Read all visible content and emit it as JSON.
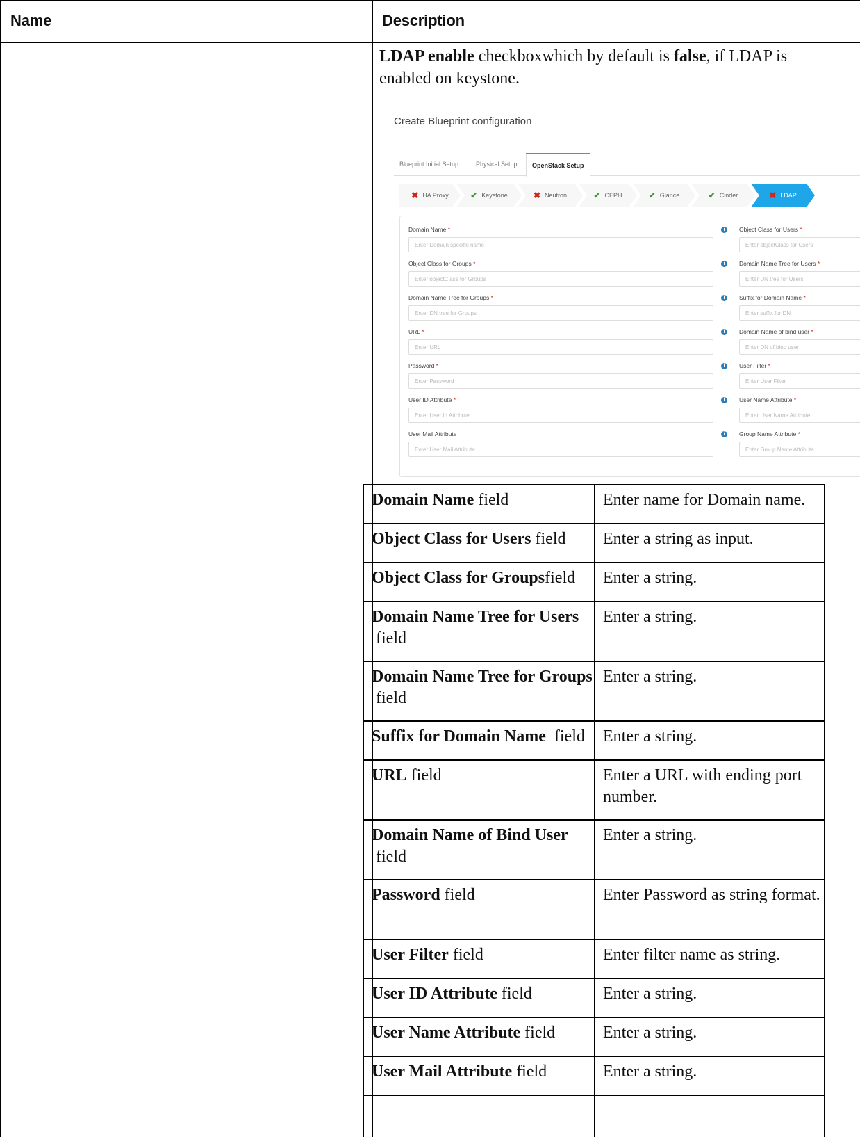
{
  "header": {
    "name": "Name",
    "description": "Description"
  },
  "intro": {
    "part1_bold": "LDAP enable",
    "part2": " checkboxwhich by default is ",
    "part3_bold": "false",
    "part4": ", if LDAP is enabled on keystone."
  },
  "screenshot": {
    "title": "Create Blueprint configuration",
    "tabs": [
      "Blueprint Initial Setup",
      "Physical Setup",
      "OpenStack Setup"
    ],
    "active_tab": "OpenStack Setup",
    "steps": [
      {
        "label": "HA Proxy",
        "status": "error"
      },
      {
        "label": "Keystone",
        "status": "ok"
      },
      {
        "label": "Neutron",
        "status": "error"
      },
      {
        "label": "CEPH",
        "status": "ok"
      },
      {
        "label": "Glance",
        "status": "ok"
      },
      {
        "label": "Cinder",
        "status": "ok"
      },
      {
        "label": "LDAP",
        "status": "error"
      }
    ],
    "marks": {
      "error": "✖",
      "ok": "✔"
    },
    "info_glyph": "i",
    "required_mark": " *",
    "left_fields": [
      {
        "label": "Domain Name",
        "required": true,
        "placeholder": "Enter Domain specific name"
      },
      {
        "label": "Object Class for Groups",
        "required": true,
        "placeholder": "Enter objectClass for Groups"
      },
      {
        "label": "Domain Name Tree for Groups",
        "required": true,
        "placeholder": "Enter DN tree for Groups"
      },
      {
        "label": "URL",
        "required": true,
        "placeholder": "Enter URL"
      },
      {
        "label": "Password",
        "required": true,
        "placeholder": "Enter Password"
      },
      {
        "label": "User ID Attribute",
        "required": true,
        "placeholder": "Enter User Id Attribute"
      },
      {
        "label": "User Mail Attribute",
        "required": false,
        "placeholder": "Enter User Mail Attribute"
      }
    ],
    "right_fields": [
      {
        "label": "Object Class for Users",
        "required": true,
        "placeholder": "Enter objectClass for Users"
      },
      {
        "label": "Domain Name Tree for Users",
        "required": true,
        "placeholder": "Enter DN tree for Users"
      },
      {
        "label": "Suffix for Domain Name",
        "required": true,
        "placeholder": "Enter suffix for DN"
      },
      {
        "label": "Domain Name of bind user",
        "required": true,
        "placeholder": "Enter DN of bind user"
      },
      {
        "label": "User Filter",
        "required": true,
        "placeholder": "Enter User Filter"
      },
      {
        "label": "User Name Attribute",
        "required": true,
        "placeholder": "Enter User Name Attribute"
      },
      {
        "label": "Group Name Attribute",
        "required": true,
        "placeholder": "Enter Group Name Attribute"
      }
    ]
  },
  "fields_table": [
    {
      "name_bold": "Domain Name",
      "name_suffix": " field",
      "desc": "Enter name for Domain name."
    },
    {
      "name_bold": "Object Class for Users",
      "name_suffix": " field",
      "desc": "Enter a string as input."
    },
    {
      "name_bold": "Object Class for Groups",
      "name_suffix": "field",
      "desc": "Enter a string."
    },
    {
      "name_bold": "Domain Name Tree for Users",
      "name_suffix": " field",
      "desc": "Enter a string."
    },
    {
      "name_bold": "Domain Name Tree for Groups",
      "name_suffix": " field",
      "desc": "Enter a string."
    },
    {
      "name_bold": "Suffix for Domain Name",
      "name_suffix": "  field",
      "desc": "Enter a string."
    },
    {
      "name_bold": "URL",
      "name_suffix": " field",
      "desc": "Enter a URL with ending port number."
    },
    {
      "name_bold": "Domain Name of Bind User",
      "name_suffix": " field",
      "desc": "Enter a string."
    },
    {
      "name_bold": "Password",
      "name_suffix": " field",
      "desc": "Enter Password as string format."
    },
    {
      "name_bold": "User Filter",
      "name_suffix": " field",
      "desc": "Enter filter name as string."
    },
    {
      "name_bold": "User ID Attribute",
      "name_suffix": " field",
      "desc": "Enter a string."
    },
    {
      "name_bold": "User Name Attribute",
      "name_suffix": " field",
      "desc": "Enter a string."
    },
    {
      "name_bold": "User Mail Attribute",
      "name_suffix": " field",
      "desc": "Enter a string."
    }
  ]
}
